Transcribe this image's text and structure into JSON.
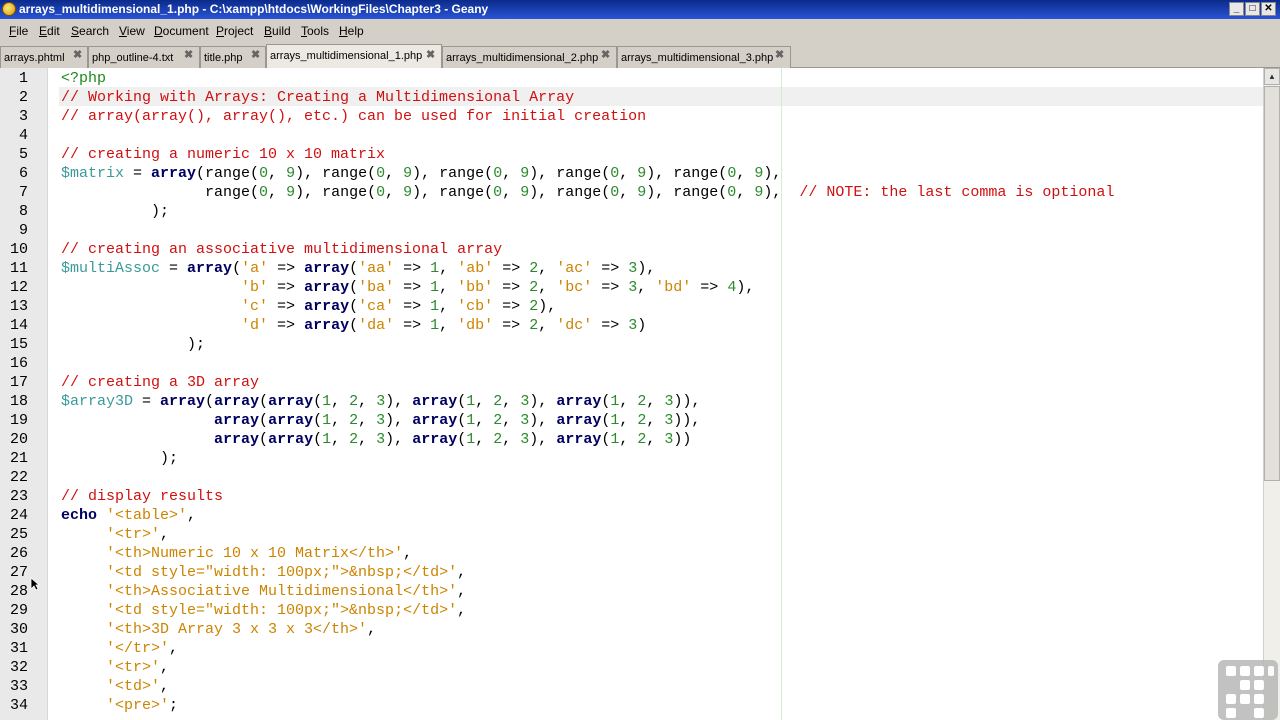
{
  "window": {
    "title": "arrays_multidimensional_1.php - C:\\xampp\\htdocs\\WorkingFiles\\Chapter3 - Geany",
    "controls": {
      "minimize": "_",
      "maximize": "□",
      "close": "✕"
    }
  },
  "menu": [
    "File",
    "Edit",
    "Search",
    "View",
    "Document",
    "Project",
    "Build",
    "Tools",
    "Help"
  ],
  "tabs": [
    {
      "label": "arrays.phtml",
      "active": false
    },
    {
      "label": "php_outline-4.txt",
      "active": false
    },
    {
      "label": "title.php",
      "active": false
    },
    {
      "label": "arrays_multidimensional_1.php",
      "active": true
    },
    {
      "label": "arrays_multidimensional_2.php",
      "active": false
    },
    {
      "label": "arrays_multidimensional_3.php",
      "active": false
    }
  ],
  "tab_close_glyph": "✖",
  "editor": {
    "current_line": 2,
    "line_numbers": [
      "1",
      "2",
      "3",
      "4",
      "5",
      "6",
      "7",
      "8",
      "9",
      "10",
      "11",
      "12",
      "13",
      "14",
      "15",
      "16",
      "17",
      "18",
      "19",
      "20",
      "21",
      "22",
      "23",
      "24",
      "25",
      "26",
      "27",
      "28",
      "29",
      "30",
      "31",
      "32",
      "33",
      "34"
    ],
    "lines": [
      [
        [
          "php",
          "<?php"
        ]
      ],
      [
        [
          "comment",
          "// Working with Arrays: Creating a Multidimensional Array"
        ]
      ],
      [
        [
          "comment",
          "// array(array(), array(), etc.) can be used for initial creation"
        ]
      ],
      [],
      [
        [
          "comment",
          "// creating a numeric 10 x 10 matrix"
        ]
      ],
      [
        [
          "var",
          "$matrix"
        ],
        [
          "plain",
          " = "
        ],
        [
          "kw",
          "array"
        ],
        [
          "plain",
          "(range("
        ],
        [
          "num",
          "0"
        ],
        [
          "plain",
          ", "
        ],
        [
          "num",
          "9"
        ],
        [
          "plain",
          "), range("
        ],
        [
          "num",
          "0"
        ],
        [
          "plain",
          ", "
        ],
        [
          "num",
          "9"
        ],
        [
          "plain",
          "), range("
        ],
        [
          "num",
          "0"
        ],
        [
          "plain",
          ", "
        ],
        [
          "num",
          "9"
        ],
        [
          "plain",
          "), range("
        ],
        [
          "num",
          "0"
        ],
        [
          "plain",
          ", "
        ],
        [
          "num",
          "9"
        ],
        [
          "plain",
          "), range("
        ],
        [
          "num",
          "0"
        ],
        [
          "plain",
          ", "
        ],
        [
          "num",
          "9"
        ],
        [
          "plain",
          "),"
        ]
      ],
      [
        [
          "plain",
          "                range("
        ],
        [
          "num",
          "0"
        ],
        [
          "plain",
          ", "
        ],
        [
          "num",
          "9"
        ],
        [
          "plain",
          "), range("
        ],
        [
          "num",
          "0"
        ],
        [
          "plain",
          ", "
        ],
        [
          "num",
          "9"
        ],
        [
          "plain",
          "), range("
        ],
        [
          "num",
          "0"
        ],
        [
          "plain",
          ", "
        ],
        [
          "num",
          "9"
        ],
        [
          "plain",
          "), range("
        ],
        [
          "num",
          "0"
        ],
        [
          "plain",
          ", "
        ],
        [
          "num",
          "9"
        ],
        [
          "plain",
          "), range("
        ],
        [
          "num",
          "0"
        ],
        [
          "plain",
          ", "
        ],
        [
          "num",
          "9"
        ],
        [
          "plain",
          "),  "
        ],
        [
          "comment",
          "// NOTE: the last comma is optional"
        ]
      ],
      [
        [
          "plain",
          "          );"
        ]
      ],
      [],
      [
        [
          "comment",
          "// creating an associative multidimensional array"
        ]
      ],
      [
        [
          "var",
          "$multiAssoc"
        ],
        [
          "plain",
          " = "
        ],
        [
          "kw",
          "array"
        ],
        [
          "plain",
          "("
        ],
        [
          "str",
          "'a'"
        ],
        [
          "plain",
          " => "
        ],
        [
          "kw",
          "array"
        ],
        [
          "plain",
          "("
        ],
        [
          "str",
          "'aa'"
        ],
        [
          "plain",
          " => "
        ],
        [
          "num",
          "1"
        ],
        [
          "plain",
          ", "
        ],
        [
          "str",
          "'ab'"
        ],
        [
          "plain",
          " => "
        ],
        [
          "num",
          "2"
        ],
        [
          "plain",
          ", "
        ],
        [
          "str",
          "'ac'"
        ],
        [
          "plain",
          " => "
        ],
        [
          "num",
          "3"
        ],
        [
          "plain",
          "),"
        ]
      ],
      [
        [
          "plain",
          "                    "
        ],
        [
          "str",
          "'b'"
        ],
        [
          "plain",
          " => "
        ],
        [
          "kw",
          "array"
        ],
        [
          "plain",
          "("
        ],
        [
          "str",
          "'ba'"
        ],
        [
          "plain",
          " => "
        ],
        [
          "num",
          "1"
        ],
        [
          "plain",
          ", "
        ],
        [
          "str",
          "'bb'"
        ],
        [
          "plain",
          " => "
        ],
        [
          "num",
          "2"
        ],
        [
          "plain",
          ", "
        ],
        [
          "str",
          "'bc'"
        ],
        [
          "plain",
          " => "
        ],
        [
          "num",
          "3"
        ],
        [
          "plain",
          ", "
        ],
        [
          "str",
          "'bd'"
        ],
        [
          "plain",
          " => "
        ],
        [
          "num",
          "4"
        ],
        [
          "plain",
          "),"
        ]
      ],
      [
        [
          "plain",
          "                    "
        ],
        [
          "str",
          "'c'"
        ],
        [
          "plain",
          " => "
        ],
        [
          "kw",
          "array"
        ],
        [
          "plain",
          "("
        ],
        [
          "str",
          "'ca'"
        ],
        [
          "plain",
          " => "
        ],
        [
          "num",
          "1"
        ],
        [
          "plain",
          ", "
        ],
        [
          "str",
          "'cb'"
        ],
        [
          "plain",
          " => "
        ],
        [
          "num",
          "2"
        ],
        [
          "plain",
          "),"
        ]
      ],
      [
        [
          "plain",
          "                    "
        ],
        [
          "str",
          "'d'"
        ],
        [
          "plain",
          " => "
        ],
        [
          "kw",
          "array"
        ],
        [
          "plain",
          "("
        ],
        [
          "str",
          "'da'"
        ],
        [
          "plain",
          " => "
        ],
        [
          "num",
          "1"
        ],
        [
          "plain",
          ", "
        ],
        [
          "str",
          "'db'"
        ],
        [
          "plain",
          " => "
        ],
        [
          "num",
          "2"
        ],
        [
          "plain",
          ", "
        ],
        [
          "str",
          "'dc'"
        ],
        [
          "plain",
          " => "
        ],
        [
          "num",
          "3"
        ],
        [
          "plain",
          ")"
        ]
      ],
      [
        [
          "plain",
          "              );"
        ]
      ],
      [],
      [
        [
          "comment",
          "// creating a 3D array"
        ]
      ],
      [
        [
          "var",
          "$array3D"
        ],
        [
          "plain",
          " = "
        ],
        [
          "kw",
          "array"
        ],
        [
          "plain",
          "("
        ],
        [
          "kw",
          "array"
        ],
        [
          "plain",
          "("
        ],
        [
          "kw",
          "array"
        ],
        [
          "plain",
          "("
        ],
        [
          "num",
          "1"
        ],
        [
          "plain",
          ", "
        ],
        [
          "num",
          "2"
        ],
        [
          "plain",
          ", "
        ],
        [
          "num",
          "3"
        ],
        [
          "plain",
          "), "
        ],
        [
          "kw",
          "array"
        ],
        [
          "plain",
          "("
        ],
        [
          "num",
          "1"
        ],
        [
          "plain",
          ", "
        ],
        [
          "num",
          "2"
        ],
        [
          "plain",
          ", "
        ],
        [
          "num",
          "3"
        ],
        [
          "plain",
          "), "
        ],
        [
          "kw",
          "array"
        ],
        [
          "plain",
          "("
        ],
        [
          "num",
          "1"
        ],
        [
          "plain",
          ", "
        ],
        [
          "num",
          "2"
        ],
        [
          "plain",
          ", "
        ],
        [
          "num",
          "3"
        ],
        [
          "plain",
          ")),"
        ]
      ],
      [
        [
          "plain",
          "                 "
        ],
        [
          "kw",
          "array"
        ],
        [
          "plain",
          "("
        ],
        [
          "kw",
          "array"
        ],
        [
          "plain",
          "("
        ],
        [
          "num",
          "1"
        ],
        [
          "plain",
          ", "
        ],
        [
          "num",
          "2"
        ],
        [
          "plain",
          ", "
        ],
        [
          "num",
          "3"
        ],
        [
          "plain",
          "), "
        ],
        [
          "kw",
          "array"
        ],
        [
          "plain",
          "("
        ],
        [
          "num",
          "1"
        ],
        [
          "plain",
          ", "
        ],
        [
          "num",
          "2"
        ],
        [
          "plain",
          ", "
        ],
        [
          "num",
          "3"
        ],
        [
          "plain",
          "), "
        ],
        [
          "kw",
          "array"
        ],
        [
          "plain",
          "("
        ],
        [
          "num",
          "1"
        ],
        [
          "plain",
          ", "
        ],
        [
          "num",
          "2"
        ],
        [
          "plain",
          ", "
        ],
        [
          "num",
          "3"
        ],
        [
          "plain",
          ")),"
        ]
      ],
      [
        [
          "plain",
          "                 "
        ],
        [
          "kw",
          "array"
        ],
        [
          "plain",
          "("
        ],
        [
          "kw",
          "array"
        ],
        [
          "plain",
          "("
        ],
        [
          "num",
          "1"
        ],
        [
          "plain",
          ", "
        ],
        [
          "num",
          "2"
        ],
        [
          "plain",
          ", "
        ],
        [
          "num",
          "3"
        ],
        [
          "plain",
          "), "
        ],
        [
          "kw",
          "array"
        ],
        [
          "plain",
          "("
        ],
        [
          "num",
          "1"
        ],
        [
          "plain",
          ", "
        ],
        [
          "num",
          "2"
        ],
        [
          "plain",
          ", "
        ],
        [
          "num",
          "3"
        ],
        [
          "plain",
          "), "
        ],
        [
          "kw",
          "array"
        ],
        [
          "plain",
          "("
        ],
        [
          "num",
          "1"
        ],
        [
          "plain",
          ", "
        ],
        [
          "num",
          "2"
        ],
        [
          "plain",
          ", "
        ],
        [
          "num",
          "3"
        ],
        [
          "plain",
          "))"
        ]
      ],
      [
        [
          "plain",
          "           );"
        ]
      ],
      [],
      [
        [
          "comment",
          "// display results"
        ]
      ],
      [
        [
          "kw",
          "echo"
        ],
        [
          "plain",
          " "
        ],
        [
          "str",
          "'<table>'"
        ],
        [
          "plain",
          ","
        ]
      ],
      [
        [
          "plain",
          "     "
        ],
        [
          "str",
          "'<tr>'"
        ],
        [
          "plain",
          ","
        ]
      ],
      [
        [
          "plain",
          "     "
        ],
        [
          "str",
          "'<th>Numeric 10 x 10 Matrix</th>'"
        ],
        [
          "plain",
          ","
        ]
      ],
      [
        [
          "plain",
          "     "
        ],
        [
          "str",
          "'<td style=\"width: 100px;\">&nbsp;</td>'"
        ],
        [
          "plain",
          ","
        ]
      ],
      [
        [
          "plain",
          "     "
        ],
        [
          "str",
          "'<th>Associative Multidimensional</th>'"
        ],
        [
          "plain",
          ","
        ]
      ],
      [
        [
          "plain",
          "     "
        ],
        [
          "str",
          "'<td style=\"width: 100px;\">&nbsp;</td>'"
        ],
        [
          "plain",
          ","
        ]
      ],
      [
        [
          "plain",
          "     "
        ],
        [
          "str",
          "'<th>3D Array 3 x 3 x 3</th>'"
        ],
        [
          "plain",
          ","
        ]
      ],
      [
        [
          "plain",
          "     "
        ],
        [
          "str",
          "'</tr>'"
        ],
        [
          "plain",
          ","
        ]
      ],
      [
        [
          "plain",
          "     "
        ],
        [
          "str",
          "'<tr>'"
        ],
        [
          "plain",
          ","
        ]
      ],
      [
        [
          "plain",
          "     "
        ],
        [
          "str",
          "'<td>'"
        ],
        [
          "plain",
          ","
        ]
      ],
      [
        [
          "plain",
          "     "
        ],
        [
          "str",
          "'<pre>'"
        ],
        [
          "plain",
          ";"
        ]
      ]
    ]
  },
  "colors": {
    "comment": "#d01010",
    "keyword": "#000060",
    "string": "#cc8400",
    "number": "#2b8a2b",
    "variable": "#3a9a9a",
    "php_tag": "#1a8a1a",
    "title_bar": "#1a3fb0",
    "chrome": "#d4d0c8"
  },
  "icons": {
    "app": "geany-icon",
    "tab_close": "close-icon",
    "scroll_up": "scroll-up-arrow-icon",
    "cursor": "mouse-pointer-icon",
    "watermark": "grid-logo-icon"
  }
}
